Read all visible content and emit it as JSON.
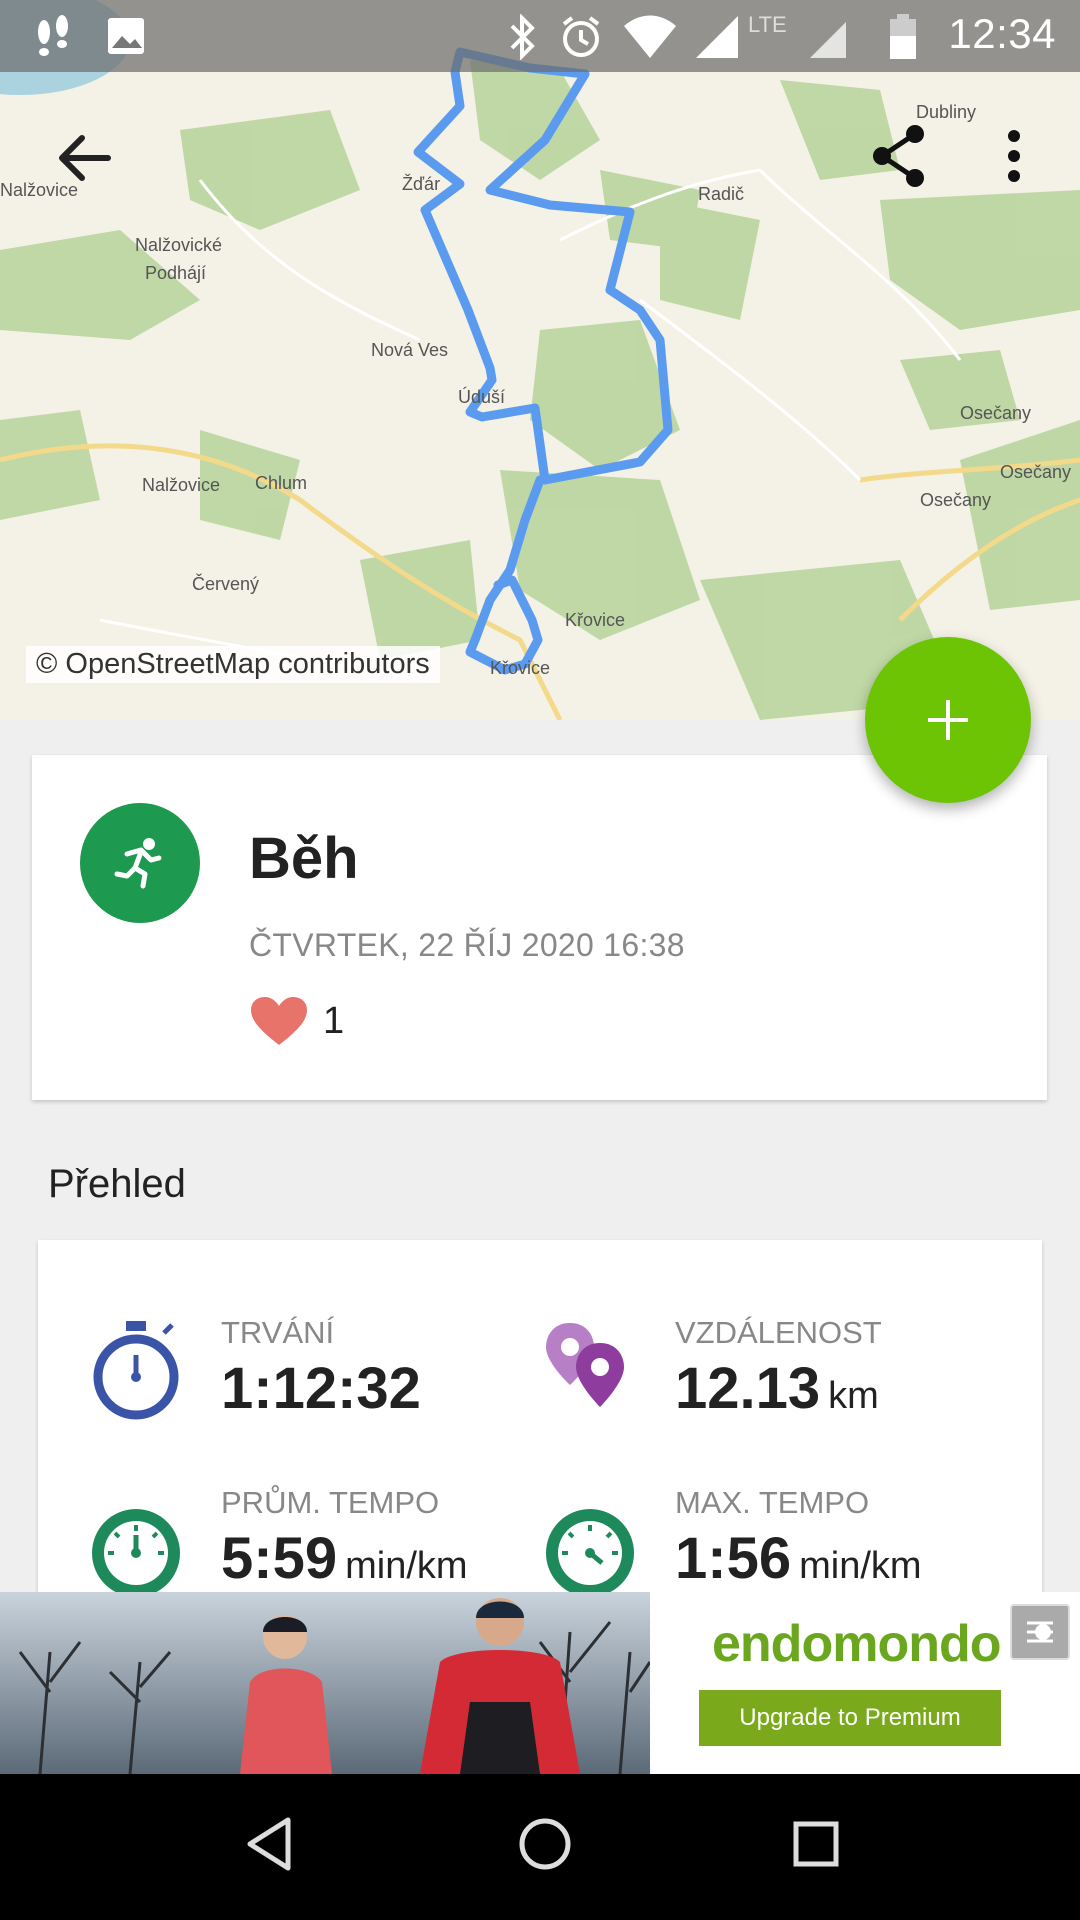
{
  "status_bar": {
    "time": "12:34",
    "network": "LTE",
    "icons": [
      "steps-icon",
      "image-icon",
      "bluetooth-icon",
      "alarm-icon",
      "wifi-icon",
      "signal-icon",
      "battery-icon"
    ]
  },
  "map": {
    "attribution": "© OpenStreetMap contributors",
    "places": {
      "nalzovice_top": "Nalžovice",
      "nalzovicke": "Nalžovické",
      "podhaji": "Podhájí",
      "zdar": "Žďár",
      "dubliny": "Dubliny",
      "radic": "Radič",
      "nova_ves": "Nová Ves",
      "ujezd": "Úduší",
      "nalzovice_mid": "Nalžovice",
      "chlum": "Chlum",
      "cerveny": "Červený",
      "osecany_1": "Osečany",
      "osecany_2": "Osečany",
      "osecany_3": "Osečany",
      "knovice": "Křovice",
      "knovice_2": "Křovice"
    },
    "route_color": "#5b9bef"
  },
  "toolbar": {
    "back_icon": "arrow-left-icon",
    "share_icon": "share-icon",
    "menu_icon": "more-vert-icon"
  },
  "fab": {
    "icon": "plus-icon",
    "color": "#6cc404"
  },
  "activity": {
    "sport_icon": "running-icon",
    "title": "Běh",
    "date": "ČTVRTEK, 22 ŘÍJ 2020 16:38",
    "likes": "1"
  },
  "overview": {
    "title": "Přehled",
    "stats": {
      "duration": {
        "label": "TRVÁNÍ",
        "value": "1:12:32",
        "unit": "",
        "icon": "stopwatch-icon"
      },
      "distance": {
        "label": "VZDÁLENOST",
        "value": "12.13",
        "unit": "km",
        "icon": "location-pins-icon"
      },
      "avg_pace": {
        "label": "PRŮM. TEMPO",
        "value": "5:59",
        "unit": "min/km",
        "icon": "speedometer-icon"
      },
      "max_pace": {
        "label": "MAX. TEMPO",
        "value": "1:56",
        "unit": "min/km",
        "icon": "speedometer-icon"
      }
    }
  },
  "ad": {
    "brand": "endomondo",
    "cta": "Upgrade to Premium"
  },
  "nav": {
    "back": "triangle-back-icon",
    "home": "circle-home-icon",
    "recents": "square-recents-icon"
  },
  "colors": {
    "accent_green": "#1e9950",
    "stat_blue": "#3a54a8",
    "stat_purple": "#8e3c9e",
    "stat_green": "#1e8a5c",
    "heart": "#e8736a"
  }
}
